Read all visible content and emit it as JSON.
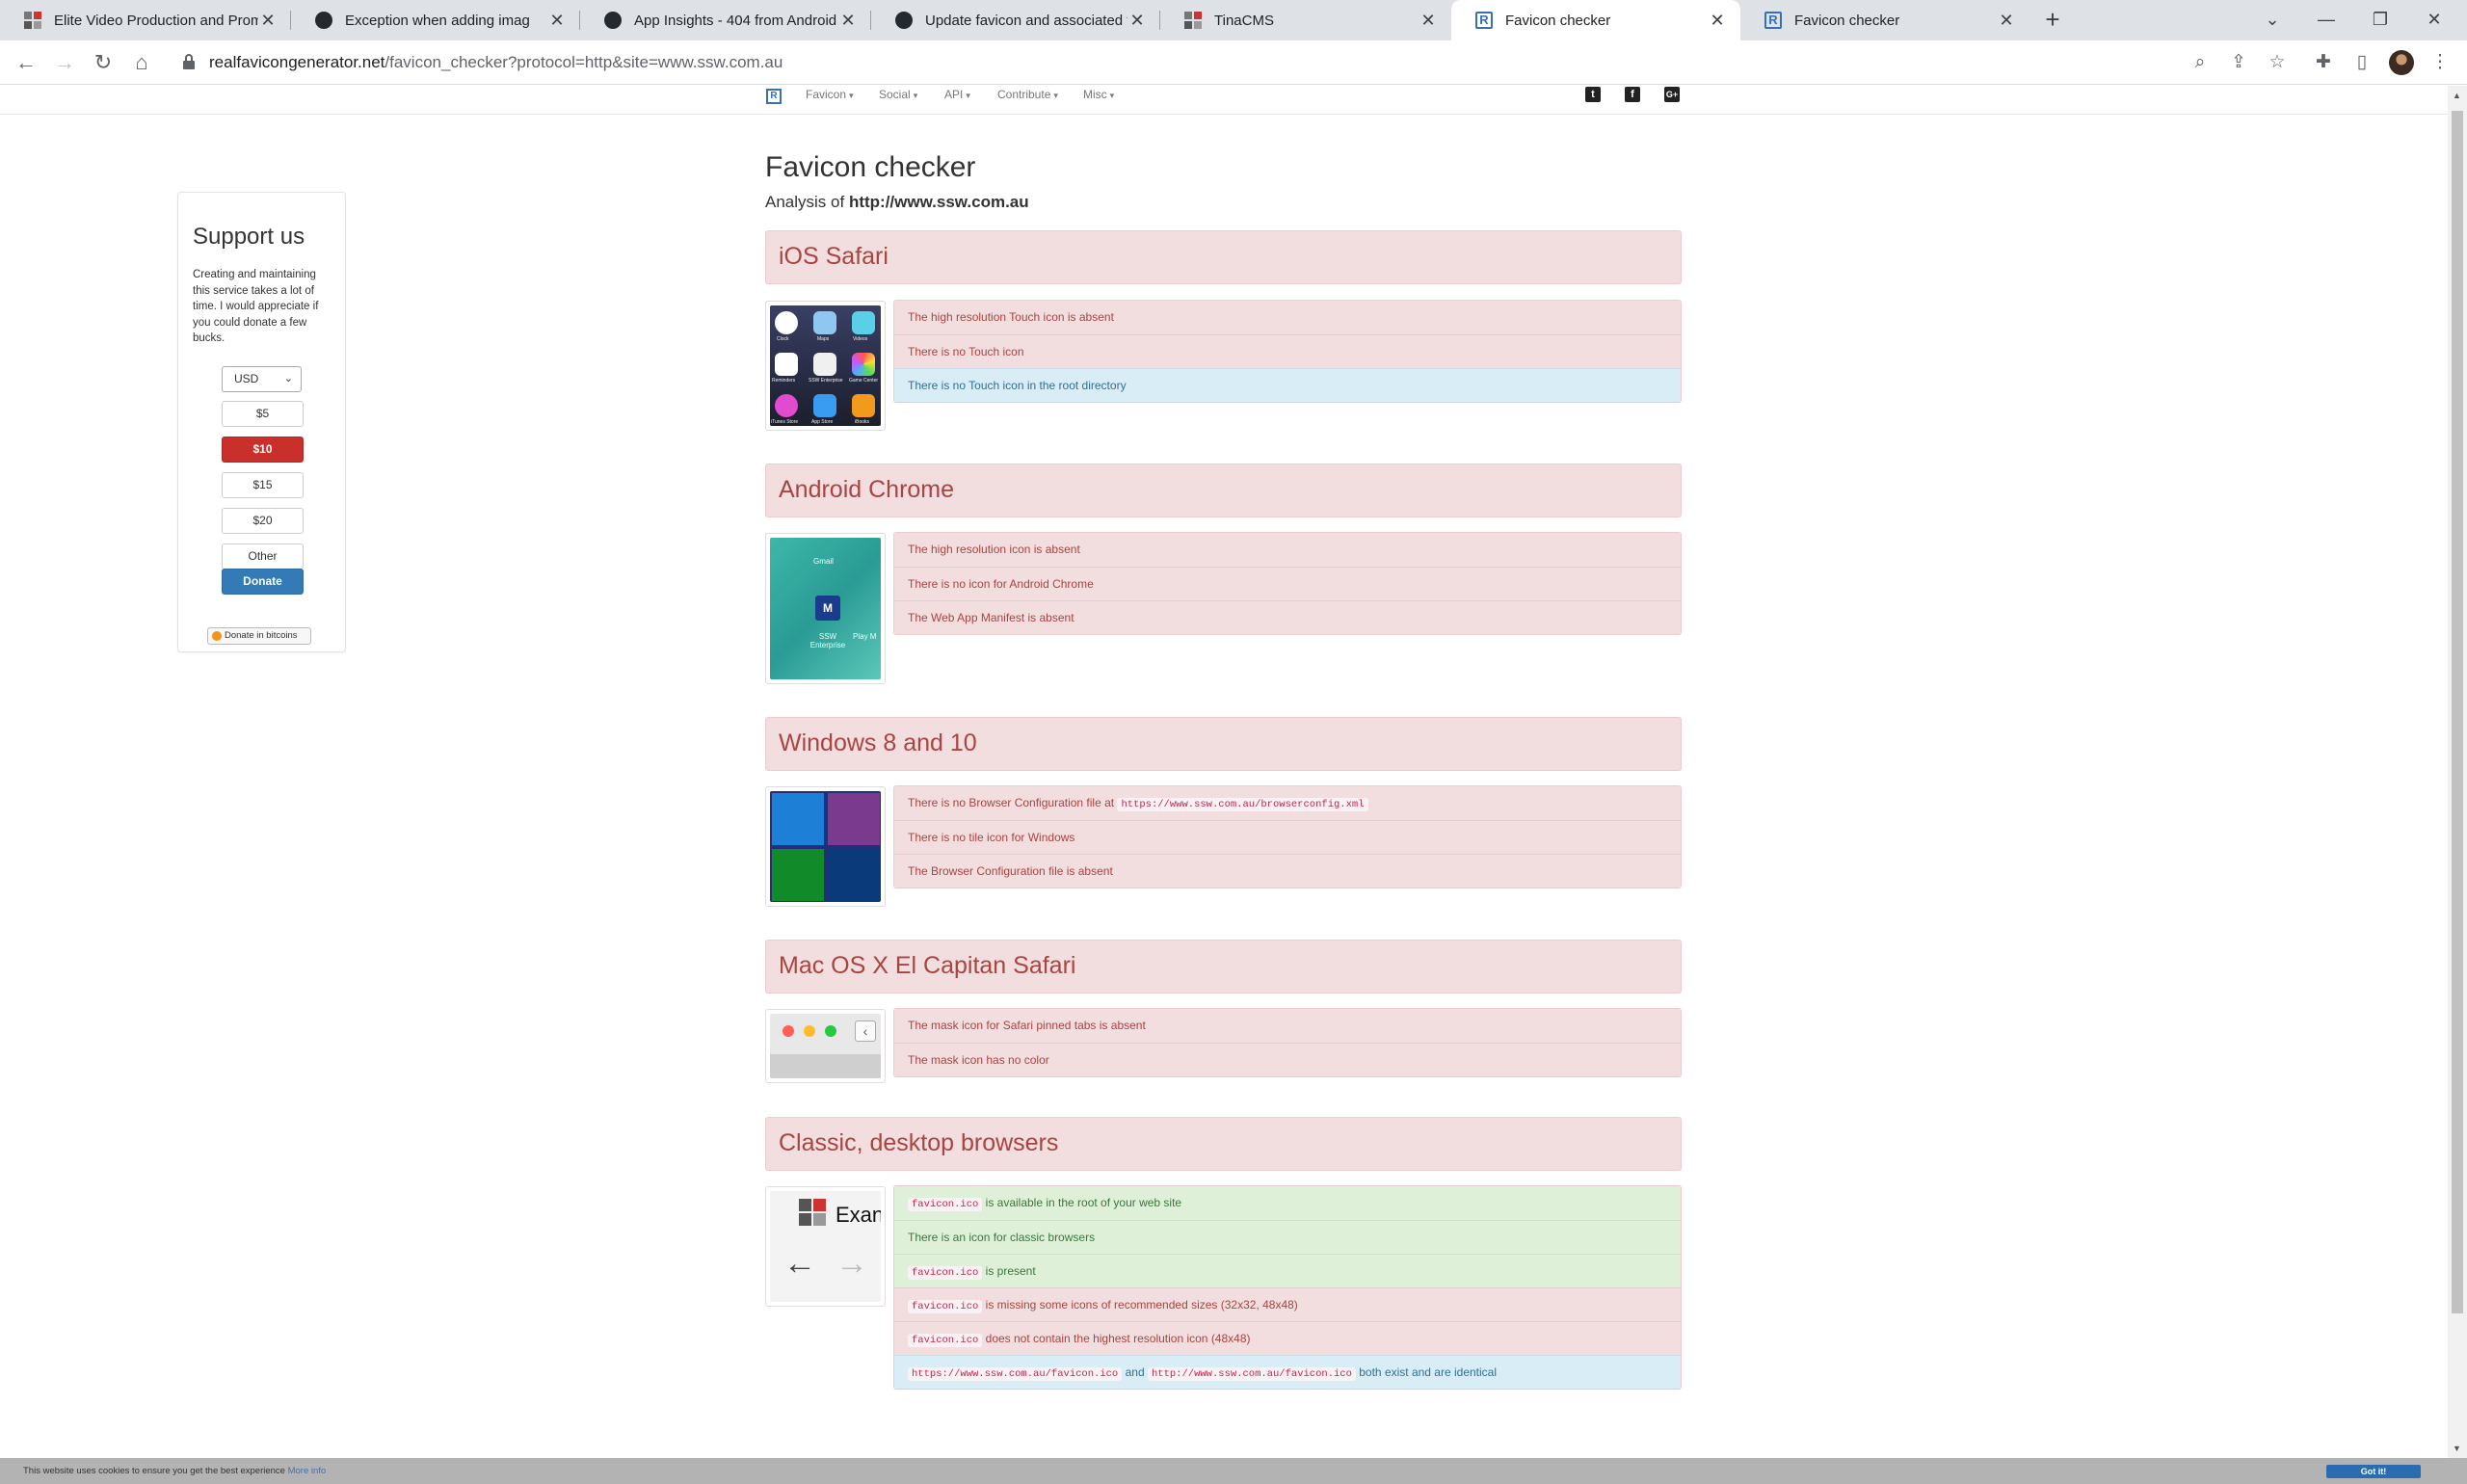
{
  "tabs": [
    {
      "title": "Elite Video Production and Prom",
      "favicon": "ssw-icon"
    },
    {
      "title": "Exception when adding imag",
      "favicon": "github-icon"
    },
    {
      "title": "App Insights - 404 from Android",
      "favicon": "github-icon"
    },
    {
      "title": "Update favicon and associated fi",
      "favicon": "github-icon"
    },
    {
      "title": "TinaCMS",
      "favicon": "ssw-icon"
    },
    {
      "title": "Favicon checker",
      "favicon": "rfg-icon"
    },
    {
      "title": "Favicon checker",
      "favicon": "rfg-icon"
    }
  ],
  "address_bar": {
    "domain": "realfavicongenerator.net",
    "path": "/favicon_checker?protocol=http&site=www.ssw.com.au"
  },
  "topnav": {
    "items": [
      "Favicon",
      "Social",
      "API",
      "Contribute",
      "Misc"
    ]
  },
  "support": {
    "title": "Support us",
    "text": "Creating and maintaining this service takes a lot of time. I would appreciate if you could donate a few bucks.",
    "currency": "USD",
    "amounts": [
      "$5",
      "$10",
      "$15",
      "$20",
      "Other"
    ],
    "selected_amount": "$10",
    "donate_label": "Donate",
    "bitcoin_label": "Donate in bitcoins"
  },
  "page": {
    "title": "Favicon checker",
    "analysis_prefix": "Analysis of",
    "analysis_site": "http://www.ssw.com.au"
  },
  "sections": {
    "ios": {
      "title": "iOS Safari",
      "messages": [
        {
          "text": "The high resolution Touch icon is absent",
          "status": "danger"
        },
        {
          "text": "There is no Touch icon",
          "status": "danger"
        },
        {
          "text": "There is no Touch icon in the root directory",
          "status": "info"
        }
      ],
      "app_labels": [
        "Clock",
        "Maps",
        "Videos",
        "Reminders",
        "SSW Enterprise",
        "Game Center",
        "iTunes Store",
        "App Store",
        "iBooks"
      ]
    },
    "android": {
      "title": "Android Chrome",
      "messages": [
        {
          "text": "The high resolution icon is absent",
          "status": "danger"
        },
        {
          "text": "There is no icon for Android Chrome",
          "status": "danger"
        },
        {
          "text": "The Web App Manifest is absent",
          "status": "danger"
        }
      ],
      "icon_letter": "M",
      "labels": [
        "Gmail",
        "SSW Enterprise",
        "Play M"
      ]
    },
    "windows": {
      "title": "Windows 8 and 10",
      "msg1_prefix": "There is no Browser Configuration file at",
      "msg1_code": "https://www.ssw.com.au/browserconfig.xml",
      "msg2": "There is no tile icon for Windows",
      "msg3": "The Browser Configuration file is absent"
    },
    "mac": {
      "title": "Mac OS X El Capitan Safari",
      "messages": [
        {
          "text": "The mask icon for Safari pinned tabs is absent",
          "status": "danger"
        },
        {
          "text": "The mask icon has no color",
          "status": "danger"
        }
      ]
    },
    "classic": {
      "title": "Classic, desktop browsers",
      "code_favicon": "favicon.ico",
      "m1_rest": "is available in the root of your web site",
      "m2": "There is an icon for classic browsers",
      "m3_rest": "is present",
      "m4_rest": "is missing some icons of recommended sizes (32x32, 48x48)",
      "m5_rest": "does not contain the highest resolution icon (48x48)",
      "m6_code1": "https://www.ssw.com.au/favicon.ico",
      "m6_and": "and",
      "m6_code2": "http://www.ssw.com.au/favicon.ico",
      "m6_rest": "both exist and are identical",
      "tab_preview_text": "Exan"
    }
  },
  "cookie": {
    "text": "This website uses cookies to ensure you get the best experience",
    "more": "More info",
    "button": "Got it!"
  },
  "colors": {
    "danger_bg": "#f2dede",
    "danger_text": "#a94442",
    "info_bg": "#d9edf7",
    "success_bg": "#dff0d8",
    "donate_selected": "#c9302c",
    "donate_button": "#337ab7"
  }
}
